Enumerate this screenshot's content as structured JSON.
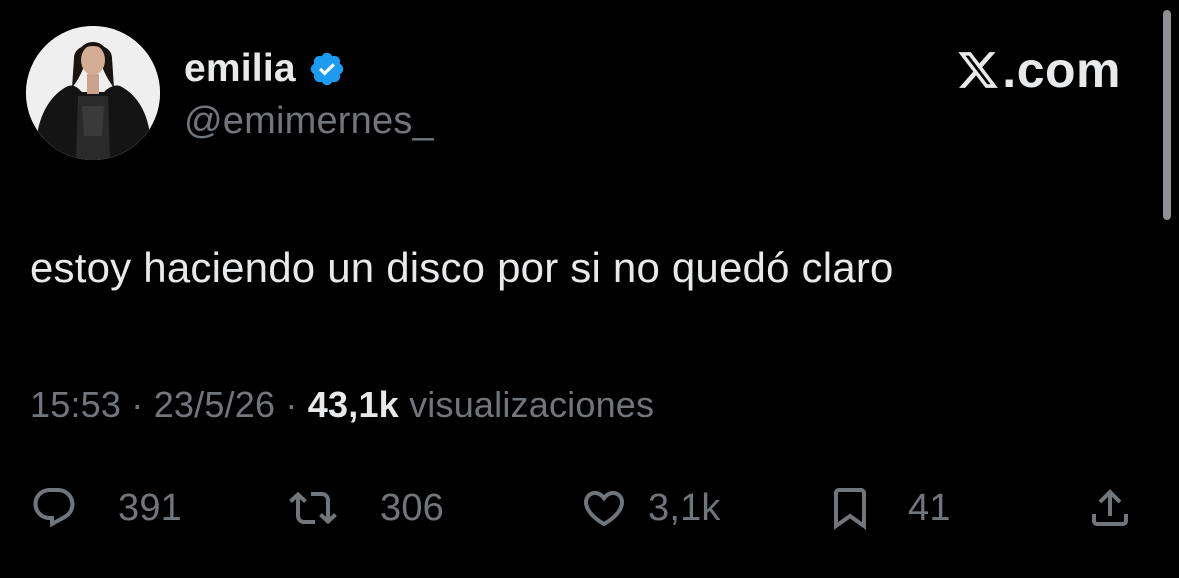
{
  "author": {
    "display_name": "emilia",
    "handle": "@emimernes_",
    "verified": true,
    "verified_color": "#1d9bf0"
  },
  "brand": {
    "icon": "x-logo-icon",
    "text": ".com"
  },
  "tweet": {
    "text": "estoy haciendo un disco por si no quedó claro",
    "time": "15:53",
    "separator": " · ",
    "date": "23/5/26",
    "views_count": "43,1k",
    "views_label": "visualizaciones"
  },
  "actions": {
    "replies": {
      "icon": "reply-icon",
      "count": "391"
    },
    "reposts": {
      "icon": "repost-icon",
      "count": "306"
    },
    "likes": {
      "icon": "like-icon",
      "count": "3,1k"
    },
    "bookmarks": {
      "icon": "bookmark-icon",
      "count": "41"
    },
    "share": {
      "icon": "share-icon"
    }
  },
  "colors": {
    "background": "#000000",
    "primary_text": "#e7e9ea",
    "secondary_text": "#71767b"
  }
}
